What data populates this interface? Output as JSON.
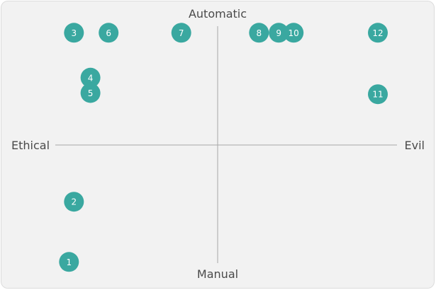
{
  "axes": {
    "top": "Automatic",
    "bottom": "Manual",
    "left": "Ethical",
    "right": "Evil"
  },
  "colors": {
    "marker": "#3aa8a0",
    "axis_line": "#a8a8a8",
    "label_text": "#4a4a4a",
    "background": "#f2f2f2"
  },
  "chart_data": {
    "type": "scatter",
    "xlabel_left": "Ethical",
    "xlabel_right": "Evil",
    "ylabel_top": "Automatic",
    "ylabel_bottom": "Manual",
    "xlim": [
      -1,
      1
    ],
    "ylim": [
      -1,
      1
    ],
    "grid": false,
    "points": [
      {
        "label": "1",
        "x": -0.9,
        "y": -0.99
      },
      {
        "label": "2",
        "x": -0.87,
        "y": -0.48
      },
      {
        "label": "3",
        "x": -0.87,
        "y": 0.95
      },
      {
        "label": "4",
        "x": -0.77,
        "y": 0.57
      },
      {
        "label": "5",
        "x": -0.77,
        "y": 0.44
      },
      {
        "label": "6",
        "x": -0.66,
        "y": 0.95
      },
      {
        "label": "7",
        "x": -0.22,
        "y": 0.95
      },
      {
        "label": "8",
        "x": 0.25,
        "y": 0.95
      },
      {
        "label": "9",
        "x": 0.37,
        "y": 0.95
      },
      {
        "label": "10",
        "x": 0.46,
        "y": 0.95
      },
      {
        "label": "11",
        "x": 0.97,
        "y": 0.43
      },
      {
        "label": "12",
        "x": 0.97,
        "y": 0.95
      }
    ]
  }
}
